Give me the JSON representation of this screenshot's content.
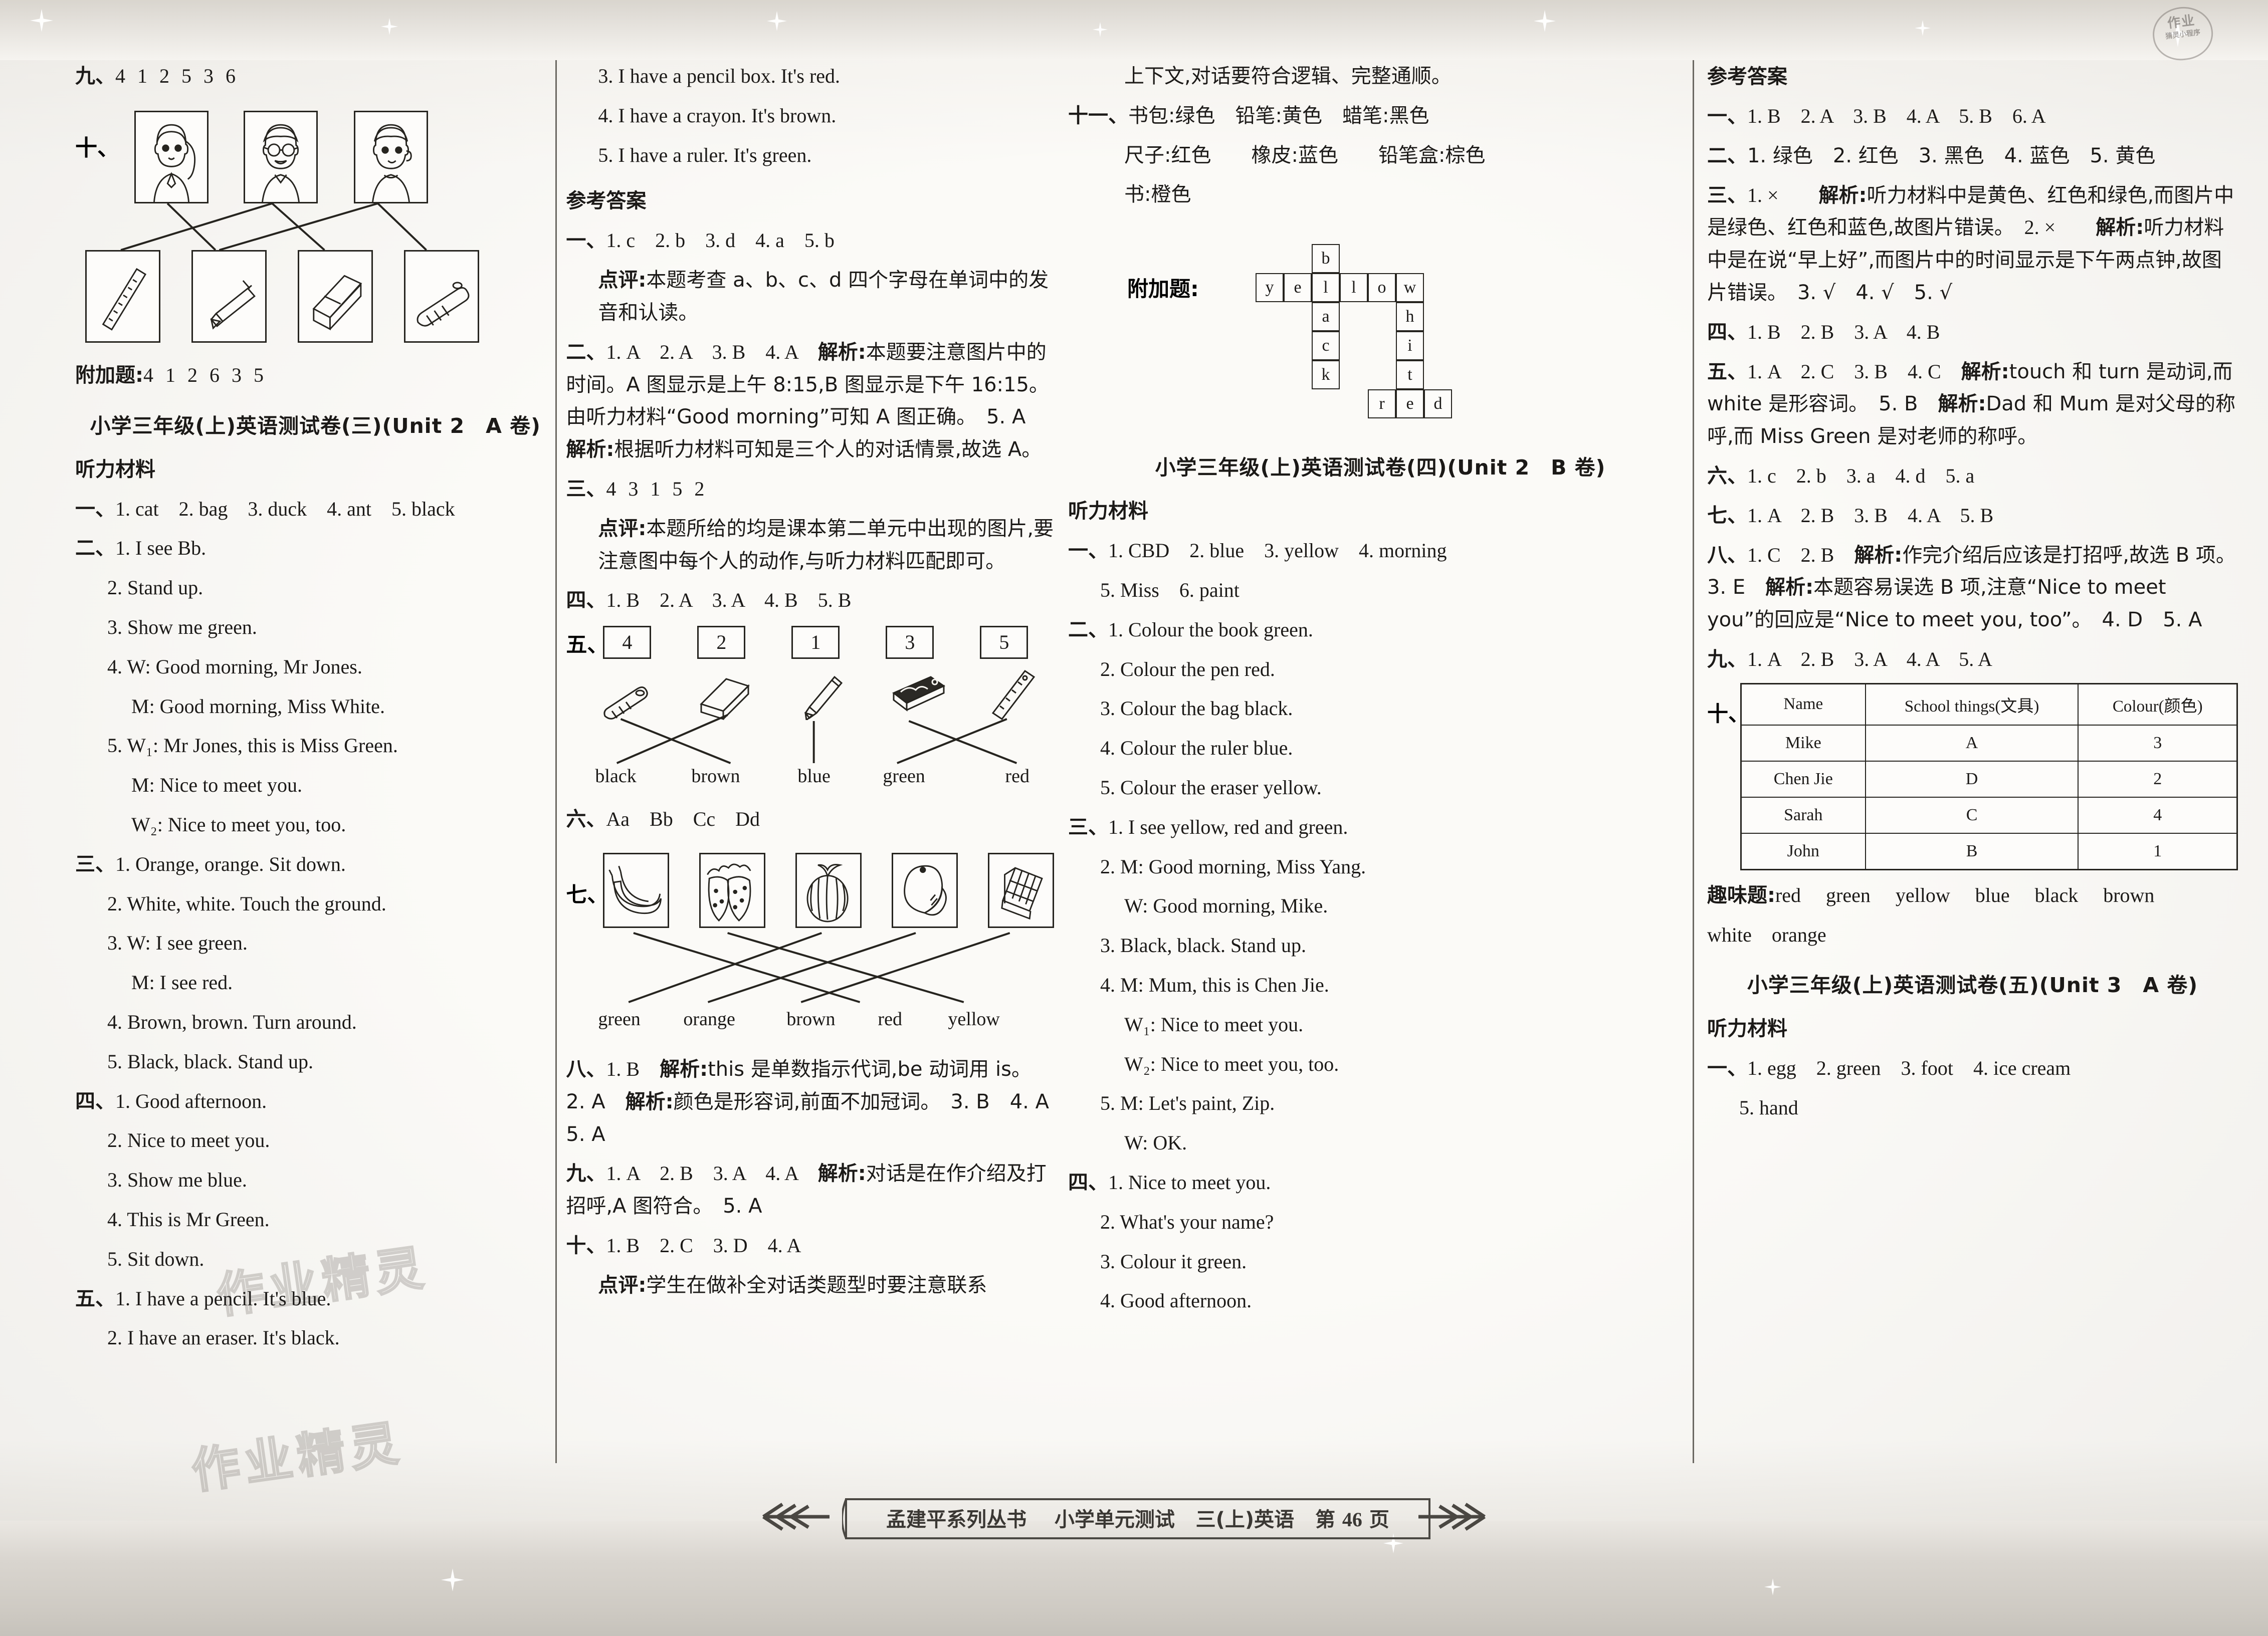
{
  "stamp": {
    "line1": "作业",
    "line2": "猜灵小程序"
  },
  "footer": {
    "series": "孟建平系列丛书",
    "title": "小学单元测试",
    "subject": "三(上)英语",
    "page_prefix": "第",
    "page_number": "46",
    "page_suffix": "页"
  },
  "watermark": "作业精灵",
  "col1": {
    "item9": {
      "label": "九、",
      "answer": "4 1 2 5 3 6"
    },
    "item10": {
      "label": "十、",
      "faces": [
        "girl-with-ponytail",
        "boy-with-glasses",
        "boy-short-hair"
      ],
      "tools": [
        "ruler",
        "pencil",
        "eraser",
        "crayon"
      ]
    },
    "bonus": {
      "label": "附加题:",
      "answer": "4 1 2 6 3 5"
    },
    "paper_title": "小学三年级(上)英语测试卷(三)(Unit 2　A 卷)",
    "listening_heading": "听力材料",
    "sections": [
      {
        "label": "一、",
        "lines": [
          {
            "indent": 0,
            "text": "1. cat　2. bag　3. duck　4. ant　5. black"
          }
        ]
      },
      {
        "label": "二、",
        "lines": [
          {
            "indent": 0,
            "text": "1. I see Bb."
          },
          {
            "indent": 1,
            "text": "2. Stand up."
          },
          {
            "indent": 1,
            "text": "3. Show me green."
          },
          {
            "indent": 1,
            "text": "4. W: Good morning, Mr Jones."
          },
          {
            "indent": 2,
            "text": "M: Good morning, Miss White."
          },
          {
            "indent": 1,
            "text": "5. W₁: Mr Jones, this is Miss Green."
          },
          {
            "indent": 2,
            "text": "M: Nice to meet you."
          },
          {
            "indent": 2,
            "text": "W₂: Nice to meet you, too."
          }
        ]
      },
      {
        "label": "三、",
        "lines": [
          {
            "indent": 0,
            "text": "1. Orange, orange.  Sit down."
          },
          {
            "indent": 1,
            "text": "2. White, white.  Touch the ground."
          },
          {
            "indent": 1,
            "text": "3. W: I see green."
          },
          {
            "indent": 2,
            "text": "M: I see red."
          },
          {
            "indent": 1,
            "text": "4. Brown, brown.  Turn around."
          },
          {
            "indent": 1,
            "text": "5. Black, black.  Stand up."
          }
        ]
      },
      {
        "label": "四、",
        "lines": [
          {
            "indent": 0,
            "text": "1. Good afternoon."
          },
          {
            "indent": 1,
            "text": "2. Nice to meet you."
          },
          {
            "indent": 1,
            "text": "3. Show me blue."
          },
          {
            "indent": 1,
            "text": "4. This is Mr Green."
          },
          {
            "indent": 1,
            "text": "5. Sit down."
          }
        ]
      },
      {
        "label": "五、",
        "lines": [
          {
            "indent": 0,
            "text": "1. I have a pencil.  It's blue."
          },
          {
            "indent": 1,
            "text": "2. I have an eraser.  It's black."
          }
        ]
      }
    ]
  },
  "col2": {
    "cont_lines": [
      {
        "indent": 1,
        "text": "3. I have a pencil box.  It's red."
      },
      {
        "indent": 1,
        "text": "4. I have a crayon.  It's brown."
      },
      {
        "indent": 1,
        "text": "5. I have a ruler.  It's green."
      }
    ],
    "answers_heading": "参考答案",
    "a1": {
      "label": "一、",
      "answer": "1. c　2. b　3. d　4. a　5. b",
      "note_label": "点评:",
      "note": "本题考查 a、b、c、d 四个字母在单词中的发音和认读。"
    },
    "a2": {
      "label": "二、",
      "answer": "1. A　2. A　3. B　4. A",
      "note_label": "解析:",
      "note": "本题要注意图片中的时间。A 图显示是上午 8:15,B 图显示是下午 16:15。由听力材料“Good morning”可知 A 图正确。　5. A　",
      "note_label2": "解析:",
      "note2": "根据听力材料可知是三个人的对话情景,故选 A。"
    },
    "a3": {
      "label": "三、",
      "answer": "4 3 1 5 2",
      "note_label": "点评:",
      "note": "本题所给的均是课本第二单元中出现的图片,要注意图中每个人的动作,与听力材料匹配即可。"
    },
    "a4": {
      "label": "四、",
      "answer": "1. B　2. A　3. A　4. B　5. B"
    },
    "a5": {
      "label": "五、",
      "boxes": [
        "4",
        "2",
        "1",
        "3",
        "5"
      ],
      "items": [
        "crayon",
        "eraser",
        "pencil",
        "pencil-box",
        "ruler"
      ],
      "colour_words": [
        "black",
        "brown",
        "blue",
        "green",
        "red"
      ]
    },
    "a6": {
      "label": "六、",
      "answer": "Aa　Bb　Cc　Dd"
    },
    "a7": {
      "label": "七、",
      "items": [
        "bananas",
        "strawberries",
        "watermelon",
        "mango",
        "chocolate"
      ],
      "colour_words": [
        "green",
        "orange",
        "brown",
        "red",
        "yellow"
      ]
    },
    "a8": {
      "label": "八、",
      "answer": "1. B　",
      "note_label": "解析:",
      "note": "this 是单数指示代词,be 动词用 is。　2. A　",
      "note_label2": "解析:",
      "note2": "颜色是形容词,前面不加冠词。　3. B　4. A　5. A"
    },
    "a9": {
      "label": "九、",
      "answer": "1. A　2. B　3. A　4. A　",
      "note_label": "解析:",
      "note": "对话是在作介绍及打招呼,A 图符合。　5. A"
    },
    "a10": {
      "label": "十、",
      "answer": "1. B　2. C　3. D　4. A",
      "note_label": "点评:",
      "note": "学生在做补全对话类题型时要注意联系"
    }
  },
  "col3": {
    "cont_text": "上下文,对话要符合逻辑、完整通顺。",
    "a11": {
      "label": "十一、",
      "line1": "书包:绿色　铅笔:黄色　蜡笔:黑色",
      "line2": "尺子:红色　　橡皮:蓝色　　铅笔盒:棕色",
      "line3": "书:橙色"
    },
    "bonus": {
      "label": "附加题:",
      "across": [
        "yellow",
        "red"
      ],
      "down": [
        "black",
        "white"
      ],
      "cells": [
        {
          "l": "b",
          "r": 0,
          "c": 2
        },
        {
          "l": "y",
          "r": 1,
          "c": 0
        },
        {
          "l": "e",
          "r": 1,
          "c": 1
        },
        {
          "l": "l",
          "r": 1,
          "c": 2
        },
        {
          "l": "l",
          "r": 1,
          "c": 3
        },
        {
          "l": "o",
          "r": 1,
          "c": 4
        },
        {
          "l": "w",
          "r": 1,
          "c": 5
        },
        {
          "l": "a",
          "r": 2,
          "c": 2
        },
        {
          "l": "h",
          "r": 2,
          "c": 5
        },
        {
          "l": "c",
          "r": 3,
          "c": 2
        },
        {
          "l": "i",
          "r": 3,
          "c": 5
        },
        {
          "l": "k",
          "r": 4,
          "c": 2
        },
        {
          "l": "t",
          "r": 4,
          "c": 5
        },
        {
          "l": "r",
          "r": 5,
          "c": 4
        },
        {
          "l": "e",
          "r": 5,
          "c": 5
        },
        {
          "l": "d",
          "r": 5,
          "c": 6
        }
      ]
    },
    "paper_title": "小学三年级(上)英语测试卷(四)(Unit 2　B 卷)",
    "listening_heading": "听力材料",
    "sections": [
      {
        "label": "一、",
        "lines": [
          {
            "indent": 0,
            "text": "1. CBD　2. blue　3. yellow　4. morning"
          },
          {
            "indent": 1,
            "text": "5. Miss　6. paint"
          }
        ]
      },
      {
        "label": "二、",
        "lines": [
          {
            "indent": 0,
            "text": "1. Colour the book green."
          },
          {
            "indent": 1,
            "text": "2. Colour the pen red."
          },
          {
            "indent": 1,
            "text": "3. Colour the bag black."
          },
          {
            "indent": 1,
            "text": "4. Colour the ruler blue."
          },
          {
            "indent": 1,
            "text": "5. Colour the eraser yellow."
          }
        ]
      },
      {
        "label": "三、",
        "lines": [
          {
            "indent": 0,
            "text": "1. I see yellow, red and green."
          },
          {
            "indent": 1,
            "text": "2. M: Good morning, Miss Yang."
          },
          {
            "indent": 2,
            "text": "W: Good morning, Mike."
          },
          {
            "indent": 1,
            "text": "3. Black, black.  Stand up."
          },
          {
            "indent": 1,
            "text": "4. M: Mum, this is Chen Jie."
          },
          {
            "indent": 2,
            "text": "W₁: Nice to meet you."
          },
          {
            "indent": 2,
            "text": "W₂: Nice to meet you, too."
          },
          {
            "indent": 1,
            "text": "5. M: Let's paint, Zip."
          },
          {
            "indent": 2,
            "text": "W: OK."
          }
        ]
      },
      {
        "label": "四、",
        "lines": [
          {
            "indent": 0,
            "text": "1. Nice to meet you."
          },
          {
            "indent": 1,
            "text": "2. What's your name?"
          },
          {
            "indent": 1,
            "text": "3. Colour it green."
          },
          {
            "indent": 1,
            "text": "4. Good afternoon."
          }
        ]
      }
    ]
  },
  "col4": {
    "answers_heading": "参考答案",
    "b1": {
      "label": "一、",
      "answer": "1. B　2. A　3. B　4. A　5. B　6. A"
    },
    "b2": {
      "label": "二、",
      "answer": "1. 绿色　2. 红色　3. 黑色　4. 蓝色　5. 黄色"
    },
    "b3": {
      "label": "三、",
      "answer": "1. ×　",
      "note_label": "解析:",
      "note": "听力材料中是黄色、红色和绿色,而图片中是绿色、红色和蓝色,故图片错误。",
      "answer2": "2. ×　",
      "note_label2": "解析:",
      "note2": "听力材料中是在说“早上好”,而图片中的时间显示是下午两点钟,故图片错误。　3. √　4. √　5. √"
    },
    "b4": {
      "label": "四、",
      "answer": "1. B　2. B　3. A　4. B"
    },
    "b5": {
      "label": "五、",
      "answer": "1. A　2. C　3. B　4. C　",
      "note_label": "解析:",
      "note": "touch 和 turn 是动词,而 white 是形容词。　5. B　",
      "note_label2": "解析:",
      "note2": "Dad 和 Mum 是对父母的称呼,而 Miss Green 是对老师的称呼。"
    },
    "b6": {
      "label": "六、",
      "answer": "1. c　2. b　3. a　4. d　5. a"
    },
    "b7": {
      "label": "七、",
      "answer": "1. A　2. B　3. B　4. A　5. B"
    },
    "b8": {
      "label": "八、",
      "answer": "1. C　2. B　",
      "note_label": "解析:",
      "note": "作完介绍后应该是打招呼,故选 B 项。　3. E　",
      "note_label2": "解析:",
      "note2": "本题容易误选 B 项,注意“Nice to meet you”的回应是“Nice to meet you, too”。　4. D　5. A"
    },
    "b9": {
      "label": "九、",
      "answer": "1. A　2. B　3. A　4. A　5. A"
    },
    "b10": {
      "label": "十、",
      "columns": [
        "Name",
        "School things(文具)",
        "Colour(颜色)"
      ],
      "rows": [
        [
          "Mike",
          "A",
          "3"
        ],
        [
          "Chen Jie",
          "D",
          "2"
        ],
        [
          "Sarah",
          "C",
          "4"
        ],
        [
          "John",
          "B",
          "1"
        ]
      ]
    },
    "fun": {
      "label": "趣味题:",
      "line1": "red　 green　 yellow　 blue　 black　 brown",
      "line2": "white　orange"
    },
    "paper_title": "小学三年级(上)英语测试卷(五)(Unit 3　A 卷)",
    "listening_heading": "听力材料",
    "sections": [
      {
        "label": "一、",
        "lines": [
          {
            "indent": 0,
            "text": "1. egg　2. green　3. foot　4. ice cream"
          },
          {
            "indent": 1,
            "text": "5. hand"
          }
        ]
      }
    ]
  }
}
